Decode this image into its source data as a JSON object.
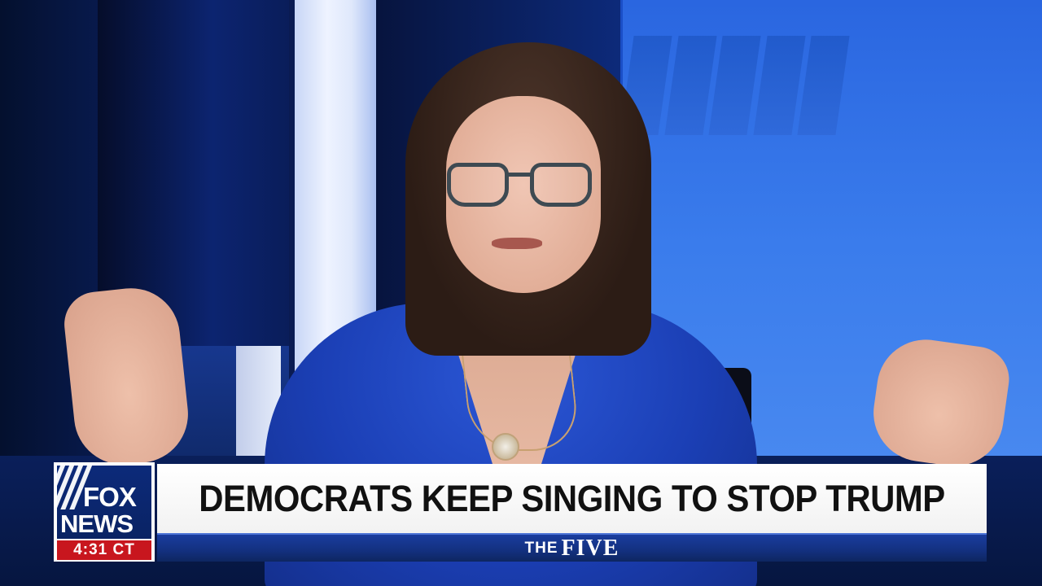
{
  "network": {
    "logo_line1": "FOX",
    "logo_line2": "NEWS",
    "clock": "4:31 CT",
    "logo_color": "#0c2a7a",
    "clock_color": "#c8161e"
  },
  "lower_third": {
    "headline": "DEMOCRATS KEEP SINGING TO STOP TRUMP",
    "show_prefix": "THE",
    "show_name": "FIVE",
    "bar_color": "#13307f"
  },
  "scene": {
    "subject": "news-anchor-icon",
    "background_color": "#2a66e0"
  }
}
